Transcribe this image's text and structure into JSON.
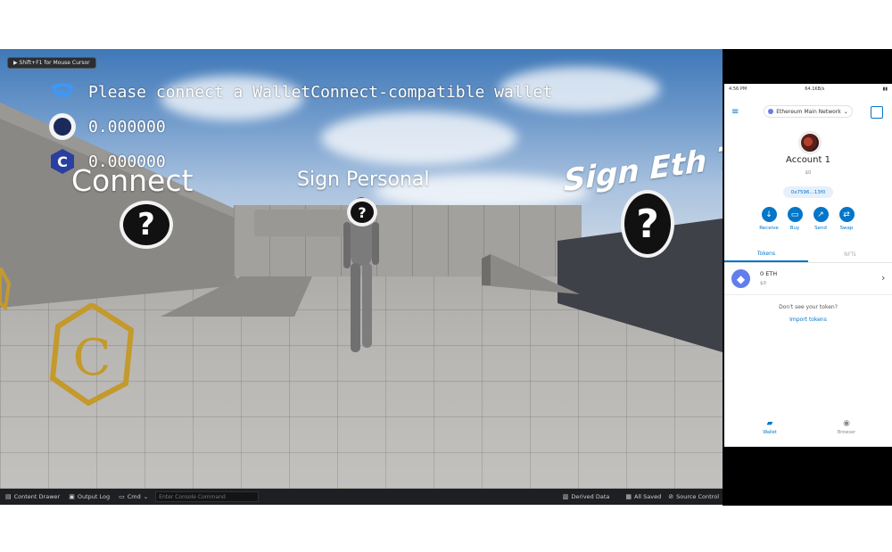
{
  "game": {
    "cursor_hint": "Shift+F1 for Mouse Cursor",
    "hud": {
      "walletconnect_prompt": "Please connect a WalletConnect-compatible wallet",
      "cro_balance": "0.000000",
      "second_balance": "0.000000"
    },
    "world_labels": {
      "connect": "Connect",
      "sign_personal": "Sign Personal",
      "sign_eth": "Sign Eth Tra"
    },
    "question_mark": "?"
  },
  "statusbar": {
    "content_drawer": "Content Drawer",
    "output_log": "Output Log",
    "cmd": "Cmd",
    "cmd_placeholder": "Enter Console Command",
    "derived_data": "Derived Data",
    "all_saved": "All Saved",
    "source_control": "Source Control"
  },
  "wallet": {
    "status_time": "4:56 PM",
    "status_net": "64.1KB/s",
    "network": "Ethereum Main Network",
    "account_name": "Account 1",
    "account_balance": "$0",
    "address": "0x7596...13f0",
    "actions": [
      "Receive",
      "Buy",
      "Send",
      "Swap"
    ],
    "tabs": [
      "Tokens",
      "NFTs"
    ],
    "token": {
      "symbol": "0 ETH",
      "fiat": "$0"
    },
    "hint": "Don't see your token?",
    "import_link": "Import tokens",
    "nav": [
      "Wallet",
      "Browser"
    ]
  },
  "colors": {
    "metamask_blue": "#0376c9",
    "eth_purple": "#627eea",
    "editor_bg": "#1e1f22"
  }
}
